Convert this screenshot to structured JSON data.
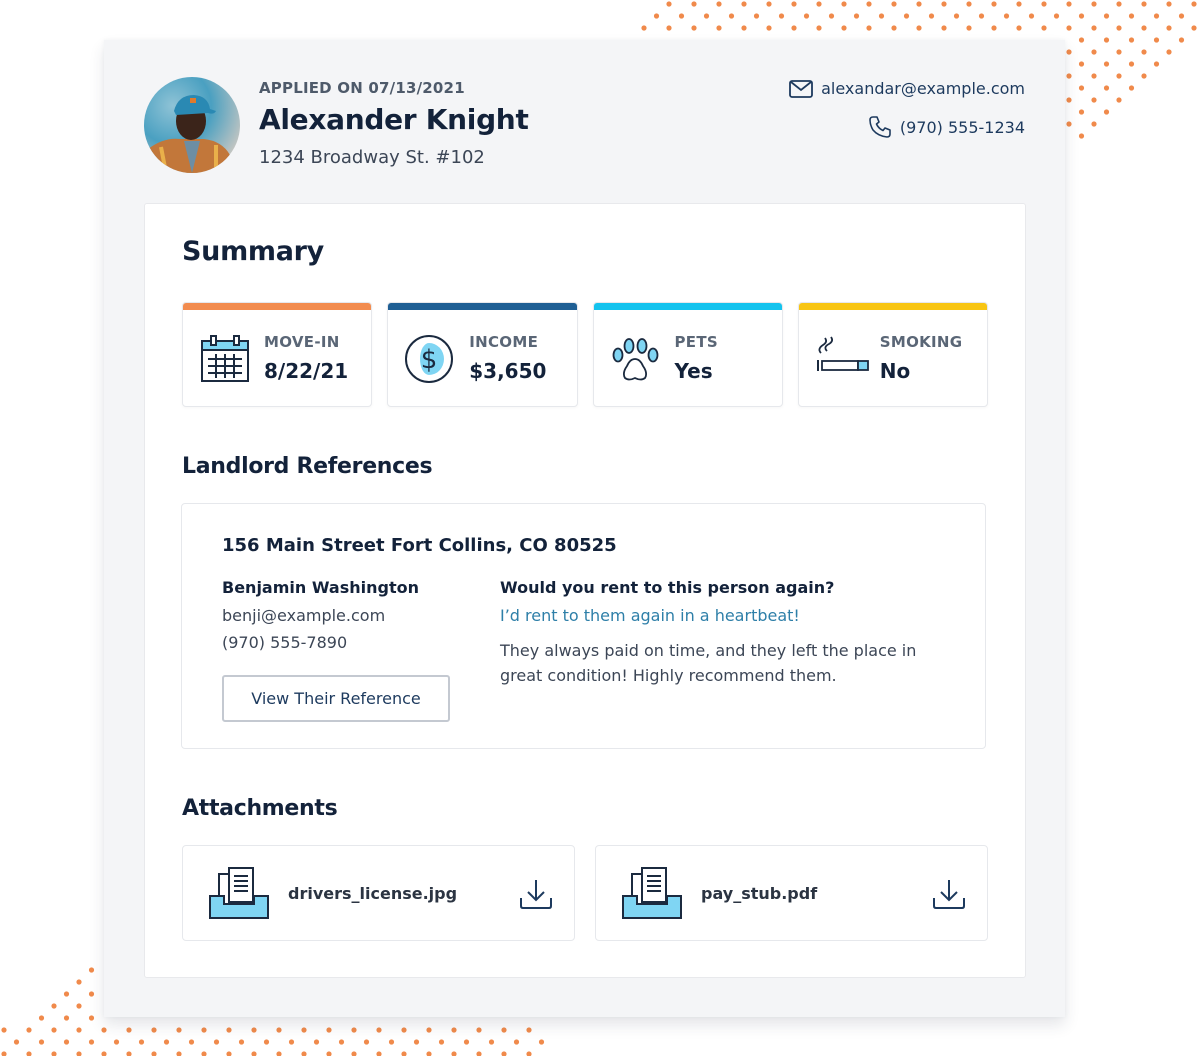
{
  "applicant": {
    "applied_label": "APPLIED ON 07/13/2021",
    "name": "Alexander Knight",
    "address": "1234 Broadway St. #102",
    "email": "alexandar@example.com",
    "phone": "(970) 555-1234",
    "avatar_icon": "person-photo"
  },
  "summary": {
    "title": "Summary",
    "stats": [
      {
        "label": "MOVE-IN",
        "value": "8/22/21",
        "icon": "calendar-icon",
        "color": "#f28c4f"
      },
      {
        "label": "INCOME",
        "value": "$3,650",
        "icon": "dollar-icon",
        "color": "#1f5f94"
      },
      {
        "label": "PETS",
        "value": "Yes",
        "icon": "paw-icon",
        "color": "#14c3ee"
      },
      {
        "label": "SMOKING",
        "value": "No",
        "icon": "cigarette-icon",
        "color": "#f8c513"
      }
    ]
  },
  "references": {
    "title": "Landlord References",
    "items": [
      {
        "address": "156 Main Street Fort Collins, CO 80525",
        "name": "Benjamin Washington",
        "email": "benji@example.com",
        "phone": "(970) 555-7890",
        "button_label": "View Their Reference",
        "question": "Would you rent to this person again?",
        "answer": "I’d rent to them again in a heartbeat!",
        "comment": "They always paid on time, and they left the place in great condition! Highly recommend them."
      }
    ]
  },
  "attachments": {
    "title": "Attachments",
    "files": [
      {
        "name": "drivers_license.jpg",
        "icon": "document-tray-icon",
        "action_icon": "download-icon"
      },
      {
        "name": "pay_stub.pdf",
        "icon": "document-tray-icon",
        "action_icon": "download-icon"
      }
    ]
  },
  "colors": {
    "accent_light_blue": "#7fd5f3",
    "link_blue": "#2e7fa8",
    "navy": "#13223a",
    "dots_orange": "#f08a4b"
  }
}
